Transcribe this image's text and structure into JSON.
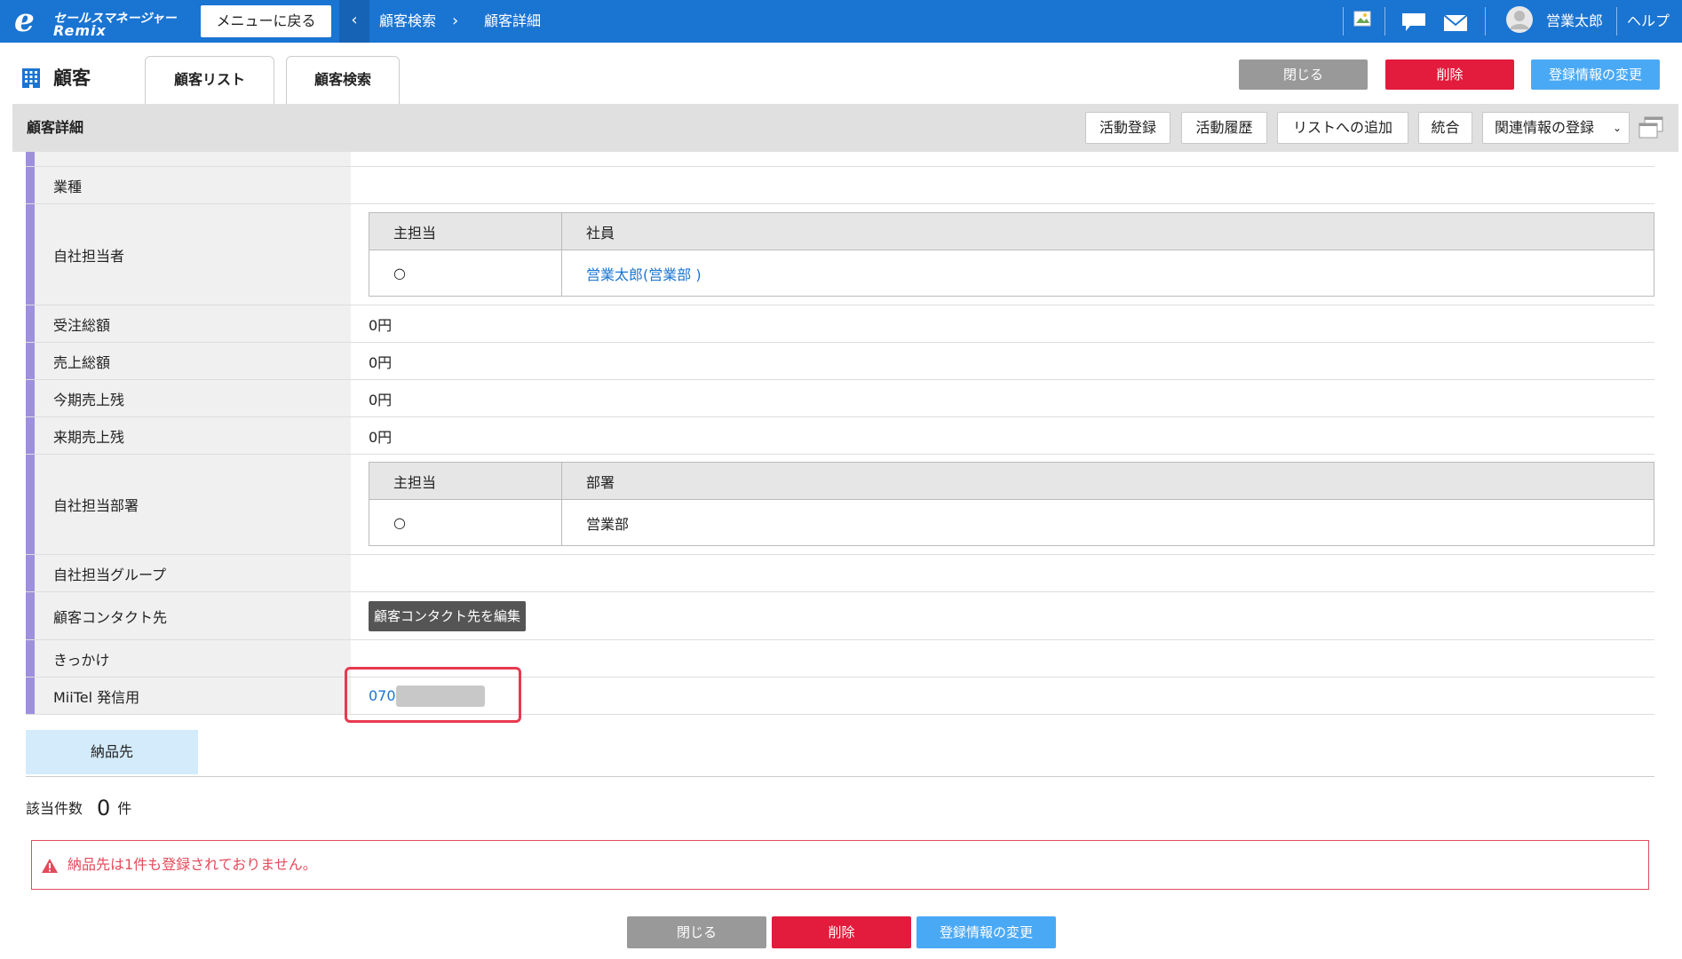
{
  "topbar": {
    "logo_line1": "セールスマネージャー",
    "logo_line2": "Remix",
    "back_label": "メニューに戻る",
    "breadcrumb": [
      "顧客検索",
      "顧客詳細"
    ],
    "user_name": "営業太郎",
    "help_label": "ヘルプ"
  },
  "header": {
    "title": "顧客",
    "tabs": [
      "顧客リスト",
      "顧客検索"
    ],
    "close_label": "閉じる",
    "delete_label": "削除",
    "edit_label": "登録情報の変更"
  },
  "section": {
    "title": "顧客詳細",
    "actions": [
      "活動登録",
      "活動履歴",
      "リストへの追加",
      "統合",
      "関連情報の登録"
    ]
  },
  "details": {
    "industry_label": "業種",
    "industry_value": "",
    "staff_label": "自社担当者",
    "staff_table": {
      "col1": "主担当",
      "col2": "社員",
      "primary_mark": "○",
      "employee": "営業太郎(営業部 )"
    },
    "order_total_label": "受注総額",
    "order_total_value": "0円",
    "sales_total_label": "売上総額",
    "sales_total_value": "0円",
    "current_term_label": "今期売上残",
    "current_term_value": "0円",
    "next_term_label": "来期売上残",
    "next_term_value": "0円",
    "dept_label": "自社担当部署",
    "dept_table": {
      "col1": "主担当",
      "col2": "部署",
      "primary_mark": "○",
      "department": "営業部"
    },
    "group_label": "自社担当グループ",
    "contact_label": "顧客コンタクト先",
    "contact_edit_label": "顧客コンタクト先を編集",
    "trigger_label": "きっかけ",
    "miitel_label": "MiiTel 発信用",
    "miitel_value": "070"
  },
  "delivery": {
    "tab_label": "納品先",
    "count_label": "該当件数",
    "count_value": "0",
    "count_unit": "件",
    "alert_message": "納品先は1件も登録されておりません。"
  },
  "footer": {
    "close_label": "閉じる",
    "delete_label": "削除",
    "edit_label": "登録情報の変更"
  },
  "colors": {
    "topbar": "#1a74d2",
    "accent_bar": "#9f8fe0",
    "delete": "#e31b3c",
    "edit": "#4aa9f5",
    "highlight": "#e8394f"
  }
}
